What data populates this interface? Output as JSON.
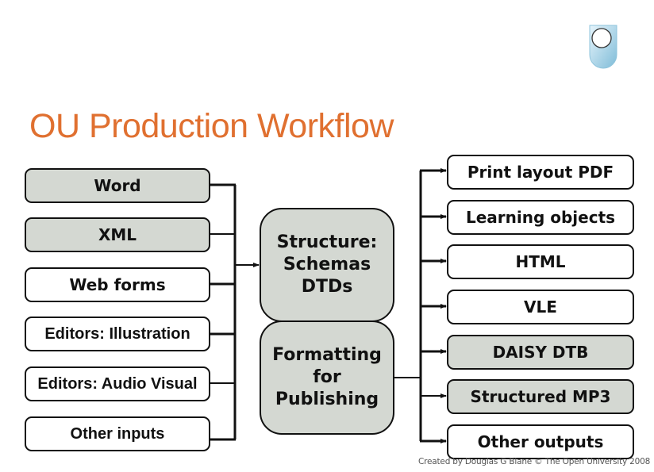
{
  "logo": {
    "icon": "open-university-shield-icon",
    "color": "#a8d4e8"
  },
  "title": "OU Production Workflow",
  "colors": {
    "title": "#e07030",
    "gray_box": "#d4d8d2",
    "line": "#111111"
  },
  "inputs": [
    {
      "label": "Word",
      "style": "gray"
    },
    {
      "label": "XML",
      "style": "gray"
    },
    {
      "label": "Web forms",
      "style": "white"
    },
    {
      "label": "Editors: Illustration",
      "style": "white"
    },
    {
      "label": "Editors: Audio Visual",
      "style": "white"
    },
    {
      "label": "Other inputs",
      "style": "white"
    }
  ],
  "process": [
    {
      "label": "Structure: Schemas DTDs",
      "lines": [
        "Structure:",
        "Schemas",
        "DTDs"
      ]
    },
    {
      "label": "Formatting for Publishing",
      "lines": [
        "Formatting",
        "for",
        "Publishing"
      ]
    }
  ],
  "outputs": [
    {
      "label": "Print layout PDF",
      "style": "white"
    },
    {
      "label": "Learning objects",
      "style": "white"
    },
    {
      "label": "HTML",
      "style": "white"
    },
    {
      "label": "VLE",
      "style": "white"
    },
    {
      "label": "DAISY DTB",
      "style": "gray"
    },
    {
      "label": "Structured MP3",
      "style": "gray"
    },
    {
      "label": "Other outputs",
      "style": "white"
    }
  ],
  "credit": "Created by Douglas G Blane © The Open University 2008"
}
